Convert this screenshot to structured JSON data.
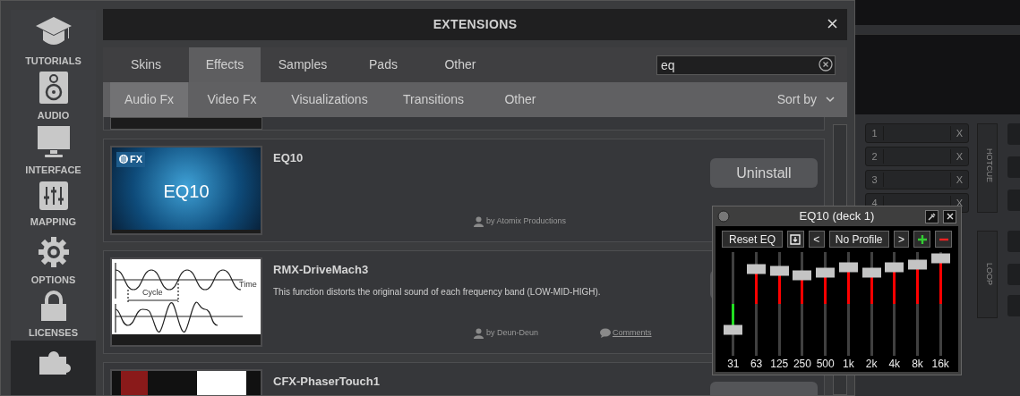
{
  "settings_window": {
    "sidebar": [
      {
        "kind": "tutorials",
        "label": "TUTORIALS",
        "selected": false
      },
      {
        "kind": "audio",
        "label": "AUDIO",
        "selected": false
      },
      {
        "kind": "interface",
        "label": "INTERFACE",
        "selected": false
      },
      {
        "kind": "mapping",
        "label": "MAPPING",
        "selected": false
      },
      {
        "kind": "options",
        "label": "OPTIONS",
        "selected": false
      },
      {
        "kind": "licenses",
        "label": "LICENSES",
        "selected": false
      },
      {
        "kind": "extensions",
        "selected": true
      }
    ],
    "title": "EXTENSIONS",
    "tabs": [
      {
        "label": "Skins",
        "selected": false
      },
      {
        "label": "Effects",
        "selected": true
      },
      {
        "label": "Samples",
        "selected": false
      },
      {
        "label": "Pads",
        "selected": false
      },
      {
        "label": "Other",
        "selected": false
      }
    ],
    "search": {
      "value": "eq"
    },
    "subtabs": [
      {
        "label": "Audio Fx",
        "selected": true
      },
      {
        "label": "Video Fx",
        "selected": false
      },
      {
        "label": "Visualizations",
        "selected": false
      },
      {
        "label": "Transitions",
        "selected": false
      },
      {
        "label": "Other",
        "selected": false
      }
    ],
    "sort": {
      "label": "Sort by"
    },
    "extensions": [
      {
        "name": "EQ10",
        "thumbnail": {
          "kind": "banner",
          "badge": "FX",
          "title": "EQ10"
        },
        "author": "by Atomix Productions",
        "button": "Uninstall"
      },
      {
        "name": "RMX-DriveMach3",
        "description": "This function distorts the original sound of each frequency band (LOW-MID-HIGH).",
        "thumbnail": {
          "kind": "wave",
          "labels": [
            "Cycle",
            "Time"
          ]
        },
        "author": "by Deun-Deun",
        "comments": "Comments"
      },
      {
        "name": "CFX-PhaserTouch1",
        "thumbnail": {
          "kind": "photo"
        }
      }
    ]
  },
  "eq_window": {
    "title": "EQ10 (deck 1)",
    "reset": "Reset EQ",
    "prev": "<",
    "profile": "No Profile",
    "next": ">",
    "bands": [
      {
        "label": "31",
        "level": 0.25
      },
      {
        "label": "63",
        "level": 0.84
      },
      {
        "label": "125",
        "level": 0.82
      },
      {
        "label": "250",
        "level": 0.78
      },
      {
        "label": "500",
        "level": 0.8
      },
      {
        "label": "1k",
        "level": 0.85
      },
      {
        "label": "2k",
        "level": 0.8
      },
      {
        "label": "4k",
        "level": 0.85
      },
      {
        "label": "8k",
        "level": 0.88
      },
      {
        "label": "16k",
        "level": 0.94
      }
    ]
  },
  "deck": {
    "hotcues": [
      {
        "number": "1",
        "clear": "X"
      },
      {
        "number": "2",
        "clear": "X"
      },
      {
        "number": "3",
        "clear": "X"
      },
      {
        "number": "4",
        "clear": "X"
      }
    ],
    "hotcue_label": "HOTCUE",
    "loop_label": "LOOP"
  }
}
